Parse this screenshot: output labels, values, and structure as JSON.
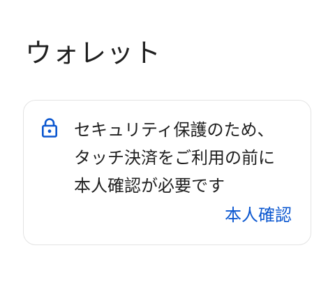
{
  "header": {
    "title": "ウォレット"
  },
  "security_card": {
    "icon": "lock-icon",
    "message_lines": [
      "セキュリティ保護のため、",
      "タッチ決済をご利用の前に",
      "本人確認が必要です"
    ],
    "action_label": "本人確認"
  },
  "colors": {
    "accent": "#0b57d0",
    "text": "#1f1f1f",
    "card_border": "#e3e3e3",
    "background": "#ffffff"
  }
}
